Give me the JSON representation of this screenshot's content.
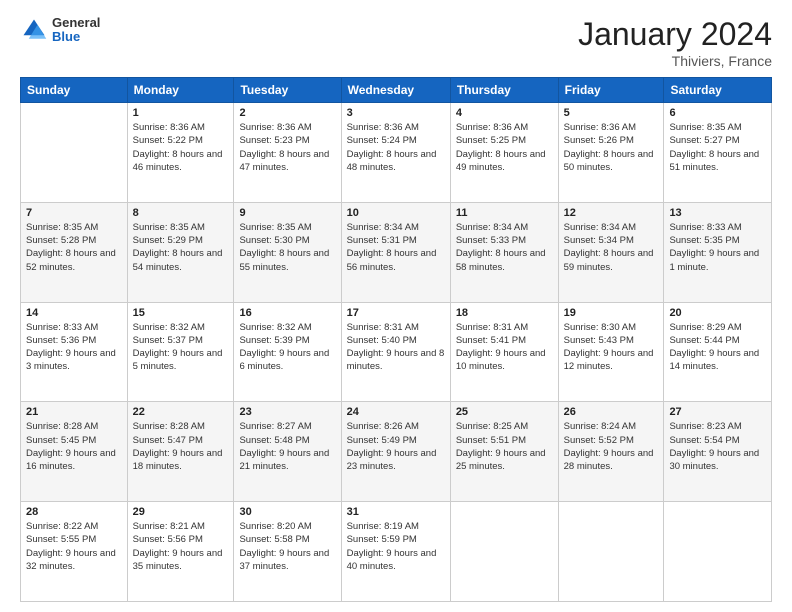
{
  "header": {
    "logo": {
      "general": "General",
      "blue": "Blue"
    },
    "title": "January 2024",
    "subtitle": "Thiviers, France"
  },
  "calendar": {
    "days_of_week": [
      "Sunday",
      "Monday",
      "Tuesday",
      "Wednesday",
      "Thursday",
      "Friday",
      "Saturday"
    ],
    "weeks": [
      [
        {
          "day": "",
          "sunrise": "",
          "sunset": "",
          "daylight": ""
        },
        {
          "day": "1",
          "sunrise": "Sunrise: 8:36 AM",
          "sunset": "Sunset: 5:22 PM",
          "daylight": "Daylight: 8 hours and 46 minutes."
        },
        {
          "day": "2",
          "sunrise": "Sunrise: 8:36 AM",
          "sunset": "Sunset: 5:23 PM",
          "daylight": "Daylight: 8 hours and 47 minutes."
        },
        {
          "day": "3",
          "sunrise": "Sunrise: 8:36 AM",
          "sunset": "Sunset: 5:24 PM",
          "daylight": "Daylight: 8 hours and 48 minutes."
        },
        {
          "day": "4",
          "sunrise": "Sunrise: 8:36 AM",
          "sunset": "Sunset: 5:25 PM",
          "daylight": "Daylight: 8 hours and 49 minutes."
        },
        {
          "day": "5",
          "sunrise": "Sunrise: 8:36 AM",
          "sunset": "Sunset: 5:26 PM",
          "daylight": "Daylight: 8 hours and 50 minutes."
        },
        {
          "day": "6",
          "sunrise": "Sunrise: 8:35 AM",
          "sunset": "Sunset: 5:27 PM",
          "daylight": "Daylight: 8 hours and 51 minutes."
        }
      ],
      [
        {
          "day": "7",
          "sunrise": "Sunrise: 8:35 AM",
          "sunset": "Sunset: 5:28 PM",
          "daylight": "Daylight: 8 hours and 52 minutes."
        },
        {
          "day": "8",
          "sunrise": "Sunrise: 8:35 AM",
          "sunset": "Sunset: 5:29 PM",
          "daylight": "Daylight: 8 hours and 54 minutes."
        },
        {
          "day": "9",
          "sunrise": "Sunrise: 8:35 AM",
          "sunset": "Sunset: 5:30 PM",
          "daylight": "Daylight: 8 hours and 55 minutes."
        },
        {
          "day": "10",
          "sunrise": "Sunrise: 8:34 AM",
          "sunset": "Sunset: 5:31 PM",
          "daylight": "Daylight: 8 hours and 56 minutes."
        },
        {
          "day": "11",
          "sunrise": "Sunrise: 8:34 AM",
          "sunset": "Sunset: 5:33 PM",
          "daylight": "Daylight: 8 hours and 58 minutes."
        },
        {
          "day": "12",
          "sunrise": "Sunrise: 8:34 AM",
          "sunset": "Sunset: 5:34 PM",
          "daylight": "Daylight: 8 hours and 59 minutes."
        },
        {
          "day": "13",
          "sunrise": "Sunrise: 8:33 AM",
          "sunset": "Sunset: 5:35 PM",
          "daylight": "Daylight: 9 hours and 1 minute."
        }
      ],
      [
        {
          "day": "14",
          "sunrise": "Sunrise: 8:33 AM",
          "sunset": "Sunset: 5:36 PM",
          "daylight": "Daylight: 9 hours and 3 minutes."
        },
        {
          "day": "15",
          "sunrise": "Sunrise: 8:32 AM",
          "sunset": "Sunset: 5:37 PM",
          "daylight": "Daylight: 9 hours and 5 minutes."
        },
        {
          "day": "16",
          "sunrise": "Sunrise: 8:32 AM",
          "sunset": "Sunset: 5:39 PM",
          "daylight": "Daylight: 9 hours and 6 minutes."
        },
        {
          "day": "17",
          "sunrise": "Sunrise: 8:31 AM",
          "sunset": "Sunset: 5:40 PM",
          "daylight": "Daylight: 9 hours and 8 minutes."
        },
        {
          "day": "18",
          "sunrise": "Sunrise: 8:31 AM",
          "sunset": "Sunset: 5:41 PM",
          "daylight": "Daylight: 9 hours and 10 minutes."
        },
        {
          "day": "19",
          "sunrise": "Sunrise: 8:30 AM",
          "sunset": "Sunset: 5:43 PM",
          "daylight": "Daylight: 9 hours and 12 minutes."
        },
        {
          "day": "20",
          "sunrise": "Sunrise: 8:29 AM",
          "sunset": "Sunset: 5:44 PM",
          "daylight": "Daylight: 9 hours and 14 minutes."
        }
      ],
      [
        {
          "day": "21",
          "sunrise": "Sunrise: 8:28 AM",
          "sunset": "Sunset: 5:45 PM",
          "daylight": "Daylight: 9 hours and 16 minutes."
        },
        {
          "day": "22",
          "sunrise": "Sunrise: 8:28 AM",
          "sunset": "Sunset: 5:47 PM",
          "daylight": "Daylight: 9 hours and 18 minutes."
        },
        {
          "day": "23",
          "sunrise": "Sunrise: 8:27 AM",
          "sunset": "Sunset: 5:48 PM",
          "daylight": "Daylight: 9 hours and 21 minutes."
        },
        {
          "day": "24",
          "sunrise": "Sunrise: 8:26 AM",
          "sunset": "Sunset: 5:49 PM",
          "daylight": "Daylight: 9 hours and 23 minutes."
        },
        {
          "day": "25",
          "sunrise": "Sunrise: 8:25 AM",
          "sunset": "Sunset: 5:51 PM",
          "daylight": "Daylight: 9 hours and 25 minutes."
        },
        {
          "day": "26",
          "sunrise": "Sunrise: 8:24 AM",
          "sunset": "Sunset: 5:52 PM",
          "daylight": "Daylight: 9 hours and 28 minutes."
        },
        {
          "day": "27",
          "sunrise": "Sunrise: 8:23 AM",
          "sunset": "Sunset: 5:54 PM",
          "daylight": "Daylight: 9 hours and 30 minutes."
        }
      ],
      [
        {
          "day": "28",
          "sunrise": "Sunrise: 8:22 AM",
          "sunset": "Sunset: 5:55 PM",
          "daylight": "Daylight: 9 hours and 32 minutes."
        },
        {
          "day": "29",
          "sunrise": "Sunrise: 8:21 AM",
          "sunset": "Sunset: 5:56 PM",
          "daylight": "Daylight: 9 hours and 35 minutes."
        },
        {
          "day": "30",
          "sunrise": "Sunrise: 8:20 AM",
          "sunset": "Sunset: 5:58 PM",
          "daylight": "Daylight: 9 hours and 37 minutes."
        },
        {
          "day": "31",
          "sunrise": "Sunrise: 8:19 AM",
          "sunset": "Sunset: 5:59 PM",
          "daylight": "Daylight: 9 hours and 40 minutes."
        },
        {
          "day": "",
          "sunrise": "",
          "sunset": "",
          "daylight": ""
        },
        {
          "day": "",
          "sunrise": "",
          "sunset": "",
          "daylight": ""
        },
        {
          "day": "",
          "sunrise": "",
          "sunset": "",
          "daylight": ""
        }
      ]
    ]
  }
}
